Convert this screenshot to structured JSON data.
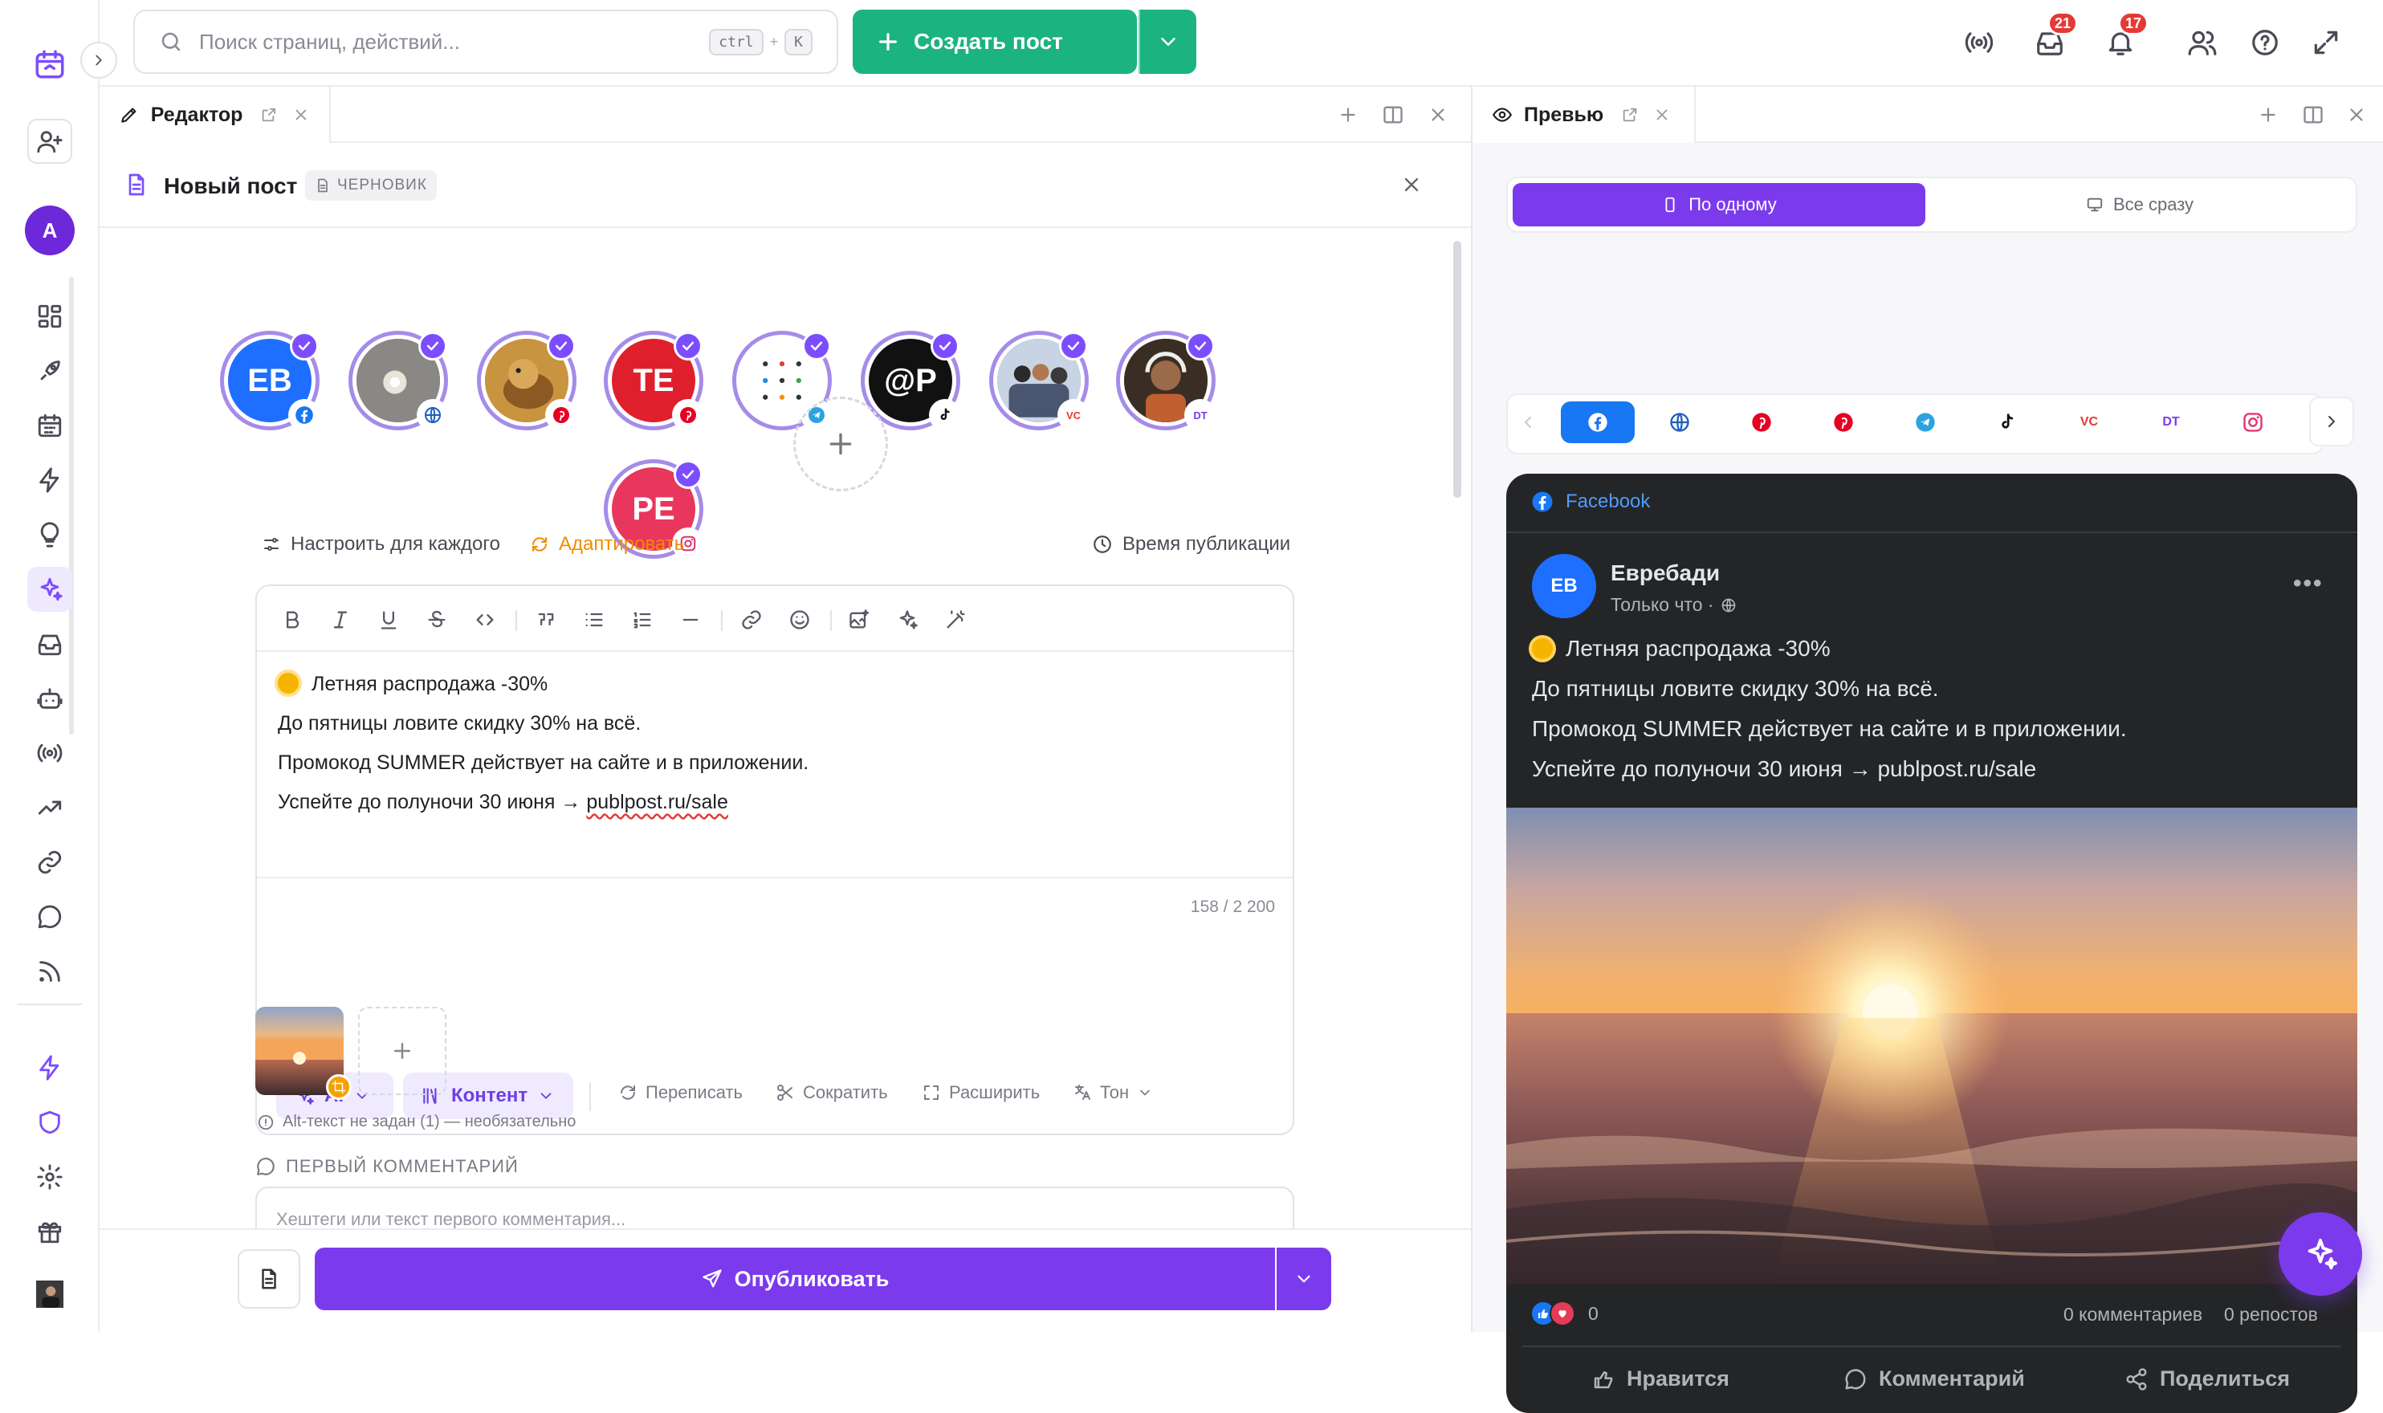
{
  "search": {
    "placeholder": "Поиск страниц, действий...",
    "kbd1": "ctrl",
    "plus": "+",
    "kbd2": "K"
  },
  "create_button": {
    "label": "Создать пост"
  },
  "notifications": {
    "inbox_count": "21",
    "bell_count": "17"
  },
  "sidebar": {
    "avatar_letter": "A"
  },
  "editor_tab": {
    "label": "Редактор"
  },
  "preview_tab": {
    "label": "Превью"
  },
  "post": {
    "title": "Новый пост",
    "status": "ЧЕРНОВИК"
  },
  "accounts": [
    {
      "initials": "EB",
      "color": "#1e6fff",
      "network": "facebook"
    },
    {
      "initials": "",
      "color": "#6b6a66",
      "network": "web"
    },
    {
      "initials": "",
      "color": "#b07a2a",
      "network": "pinterest"
    },
    {
      "initials": "TE",
      "color": "#e01f2d",
      "network": "pinterest"
    },
    {
      "initials": "",
      "color": "#ffffff",
      "network": "telegram"
    },
    {
      "initials": "@P",
      "color": "#111111",
      "network": "tiktok"
    },
    {
      "initials": "",
      "color": "#5f6f8a",
      "network": "vc"
    },
    {
      "initials": "",
      "color": "#4a3a2a",
      "network": "dt"
    },
    {
      "initials": "PE",
      "color": "#e8365d",
      "network": "instagram"
    }
  ],
  "options": {
    "customize": "Настроить для каждого",
    "adapt": "Адаптировать",
    "publish_time": "Время публикации"
  },
  "content": {
    "line1": "Летняя распродажа -30%",
    "line2": "До пятницы ловите скидку 30% на всё.",
    "line3": "Промокод SUMMER действует на сайте и в приложении.",
    "line4_prefix": "Успейте до полуночи 30 июня → ",
    "line4_link": "publpost.ru/sale"
  },
  "counter": "158 / 2 200",
  "ai_bar": {
    "ai": "AI",
    "content": "Контент",
    "rewrite": "Переписать",
    "shorten": "Сократить",
    "expand": "Расширить",
    "tone": "Тон"
  },
  "alt_text_note": "Alt-текст не задан (1) — необязательно",
  "first_comment": {
    "heading": "ПЕРВЫЙ КОММЕНТАРИЙ",
    "placeholder": "Хештеги или текст первого комментария..."
  },
  "publish_button": {
    "label": "Опубликовать"
  },
  "preview": {
    "mode_one": "По одному",
    "mode_all": "Все сразу",
    "network_label": "Facebook",
    "page_initials": "EB",
    "page_name": "Евребади",
    "time": "Только что ·",
    "reactions_count": "0",
    "comments": "0 комментариев",
    "reposts": "0 репостов",
    "like": "Нравится",
    "comment": "Комментарий",
    "share": "Поделиться"
  },
  "colors": {
    "accent": "#7c3aed",
    "green": "#1bb380",
    "fb_blue": "#1877f2",
    "badge_red": "#e53935"
  }
}
